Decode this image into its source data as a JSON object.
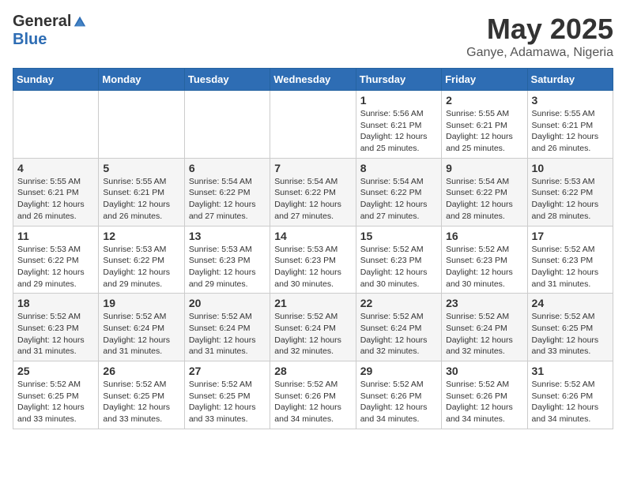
{
  "logo": {
    "general": "General",
    "blue": "Blue"
  },
  "title": "May 2025",
  "location": "Ganye, Adamawa, Nigeria",
  "days_of_week": [
    "Sunday",
    "Monday",
    "Tuesday",
    "Wednesday",
    "Thursday",
    "Friday",
    "Saturday"
  ],
  "weeks": [
    [
      {
        "day": "",
        "info": ""
      },
      {
        "day": "",
        "info": ""
      },
      {
        "day": "",
        "info": ""
      },
      {
        "day": "",
        "info": ""
      },
      {
        "day": "1",
        "info": "Sunrise: 5:56 AM\nSunset: 6:21 PM\nDaylight: 12 hours\nand 25 minutes."
      },
      {
        "day": "2",
        "info": "Sunrise: 5:55 AM\nSunset: 6:21 PM\nDaylight: 12 hours\nand 25 minutes."
      },
      {
        "day": "3",
        "info": "Sunrise: 5:55 AM\nSunset: 6:21 PM\nDaylight: 12 hours\nand 26 minutes."
      }
    ],
    [
      {
        "day": "4",
        "info": "Sunrise: 5:55 AM\nSunset: 6:21 PM\nDaylight: 12 hours\nand 26 minutes."
      },
      {
        "day": "5",
        "info": "Sunrise: 5:55 AM\nSunset: 6:21 PM\nDaylight: 12 hours\nand 26 minutes."
      },
      {
        "day": "6",
        "info": "Sunrise: 5:54 AM\nSunset: 6:22 PM\nDaylight: 12 hours\nand 27 minutes."
      },
      {
        "day": "7",
        "info": "Sunrise: 5:54 AM\nSunset: 6:22 PM\nDaylight: 12 hours\nand 27 minutes."
      },
      {
        "day": "8",
        "info": "Sunrise: 5:54 AM\nSunset: 6:22 PM\nDaylight: 12 hours\nand 27 minutes."
      },
      {
        "day": "9",
        "info": "Sunrise: 5:54 AM\nSunset: 6:22 PM\nDaylight: 12 hours\nand 28 minutes."
      },
      {
        "day": "10",
        "info": "Sunrise: 5:53 AM\nSunset: 6:22 PM\nDaylight: 12 hours\nand 28 minutes."
      }
    ],
    [
      {
        "day": "11",
        "info": "Sunrise: 5:53 AM\nSunset: 6:22 PM\nDaylight: 12 hours\nand 29 minutes."
      },
      {
        "day": "12",
        "info": "Sunrise: 5:53 AM\nSunset: 6:22 PM\nDaylight: 12 hours\nand 29 minutes."
      },
      {
        "day": "13",
        "info": "Sunrise: 5:53 AM\nSunset: 6:23 PM\nDaylight: 12 hours\nand 29 minutes."
      },
      {
        "day": "14",
        "info": "Sunrise: 5:53 AM\nSunset: 6:23 PM\nDaylight: 12 hours\nand 30 minutes."
      },
      {
        "day": "15",
        "info": "Sunrise: 5:52 AM\nSunset: 6:23 PM\nDaylight: 12 hours\nand 30 minutes."
      },
      {
        "day": "16",
        "info": "Sunrise: 5:52 AM\nSunset: 6:23 PM\nDaylight: 12 hours\nand 30 minutes."
      },
      {
        "day": "17",
        "info": "Sunrise: 5:52 AM\nSunset: 6:23 PM\nDaylight: 12 hours\nand 31 minutes."
      }
    ],
    [
      {
        "day": "18",
        "info": "Sunrise: 5:52 AM\nSunset: 6:23 PM\nDaylight: 12 hours\nand 31 minutes."
      },
      {
        "day": "19",
        "info": "Sunrise: 5:52 AM\nSunset: 6:24 PM\nDaylight: 12 hours\nand 31 minutes."
      },
      {
        "day": "20",
        "info": "Sunrise: 5:52 AM\nSunset: 6:24 PM\nDaylight: 12 hours\nand 31 minutes."
      },
      {
        "day": "21",
        "info": "Sunrise: 5:52 AM\nSunset: 6:24 PM\nDaylight: 12 hours\nand 32 minutes."
      },
      {
        "day": "22",
        "info": "Sunrise: 5:52 AM\nSunset: 6:24 PM\nDaylight: 12 hours\nand 32 minutes."
      },
      {
        "day": "23",
        "info": "Sunrise: 5:52 AM\nSunset: 6:24 PM\nDaylight: 12 hours\nand 32 minutes."
      },
      {
        "day": "24",
        "info": "Sunrise: 5:52 AM\nSunset: 6:25 PM\nDaylight: 12 hours\nand 33 minutes."
      }
    ],
    [
      {
        "day": "25",
        "info": "Sunrise: 5:52 AM\nSunset: 6:25 PM\nDaylight: 12 hours\nand 33 minutes."
      },
      {
        "day": "26",
        "info": "Sunrise: 5:52 AM\nSunset: 6:25 PM\nDaylight: 12 hours\nand 33 minutes."
      },
      {
        "day": "27",
        "info": "Sunrise: 5:52 AM\nSunset: 6:25 PM\nDaylight: 12 hours\nand 33 minutes."
      },
      {
        "day": "28",
        "info": "Sunrise: 5:52 AM\nSunset: 6:26 PM\nDaylight: 12 hours\nand 34 minutes."
      },
      {
        "day": "29",
        "info": "Sunrise: 5:52 AM\nSunset: 6:26 PM\nDaylight: 12 hours\nand 34 minutes."
      },
      {
        "day": "30",
        "info": "Sunrise: 5:52 AM\nSunset: 6:26 PM\nDaylight: 12 hours\nand 34 minutes."
      },
      {
        "day": "31",
        "info": "Sunrise: 5:52 AM\nSunset: 6:26 PM\nDaylight: 12 hours\nand 34 minutes."
      }
    ]
  ]
}
